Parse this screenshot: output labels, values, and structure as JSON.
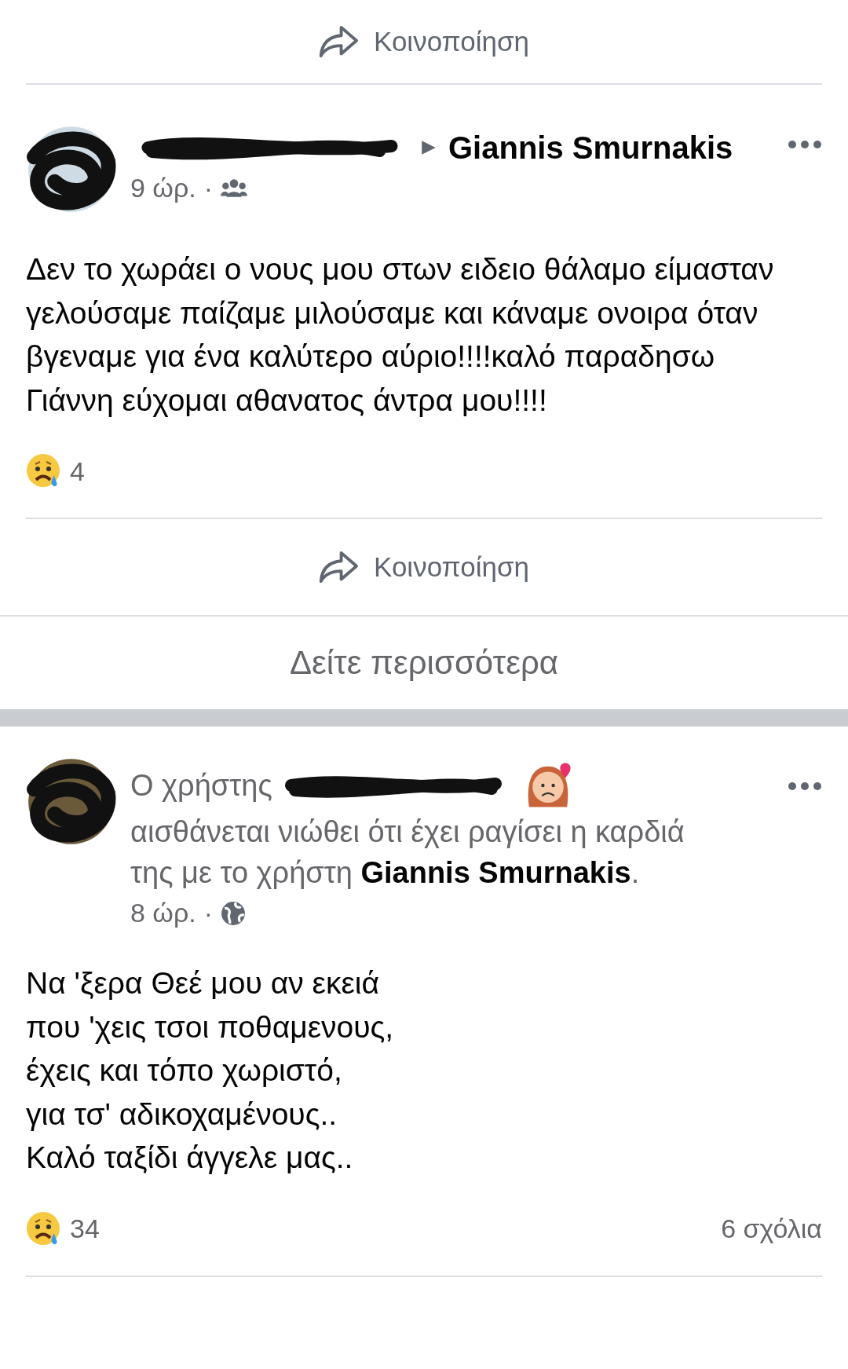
{
  "top_share": {
    "label": "Κοινοποίηση"
  },
  "posts": [
    {
      "kind": "shared",
      "author_redacted": true,
      "target": "Giannis Smurnakis",
      "time": "9 ώρ.",
      "separator": "·",
      "public_audience": false,
      "text": "Δεν το χωράει ο νους μου στων ειδειο θάλαμο είμασταν γελούσαμε παίζαμε μιλούσαμε και κάναμε ονοιρα όταν βγεναμε για ένα καλύτερο αύριο!!!!καλό παραδησω Γιάννη εύχομαι αθανατος άντρα μου!!!!",
      "reaction_count": "4",
      "share_label": "Κοινοποίηση",
      "see_more": "Δείτε περισσότερα"
    },
    {
      "kind": "feeling",
      "author_prefix": "Ο χρήστης",
      "author_redacted": true,
      "feeling": "αισθάνεται νιώθει ότι έχει ραγίσει η καρδιά της με το χρήστη **Giannis Smurnakis**.",
      "time": "8 ώρ.",
      "separator": "·",
      "public_audience": true,
      "text_lines": [
        "Να 'ξερα Θεέ μου αν εκειά",
        "που 'χεις τσοι ποθαμενους,",
        "έχεις και τόπο χωριστό,",
        "για τσ' αδικοχαμένους..",
        "Καλό ταξίδι άγγελε μας.."
      ],
      "reaction_count": "34",
      "comments": "6 σχόλια"
    }
  ]
}
